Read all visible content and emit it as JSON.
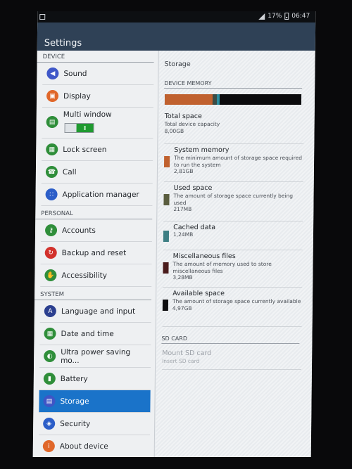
{
  "status": {
    "battery": "17%",
    "time": "06:47"
  },
  "header": {
    "title": "Settings"
  },
  "sidebar": {
    "sections": [
      {
        "header": "DEVICE",
        "items": [
          {
            "label": "Sound",
            "icon": "speaker-icon",
            "color": "#3f57c8"
          },
          {
            "label": "Display",
            "icon": "display-icon",
            "color": "#e0672a"
          },
          {
            "label": "Multi window",
            "icon": "multi-window-icon",
            "color": "#2f8e3a",
            "toggle": true
          },
          {
            "label": "Lock screen",
            "icon": "lock-screen-icon",
            "color": "#2f8e3a"
          },
          {
            "label": "Call",
            "icon": "phone-icon",
            "color": "#2f8e3a"
          },
          {
            "label": "Application manager",
            "icon": "apps-icon",
            "color": "#2c5ec8"
          }
        ]
      },
      {
        "header": "PERSONAL",
        "items": [
          {
            "label": "Accounts",
            "icon": "key-icon",
            "color": "#2f8e3a"
          },
          {
            "label": "Backup and reset",
            "icon": "backup-icon",
            "color": "#d2312c"
          },
          {
            "label": "Accessibility",
            "icon": "hand-icon",
            "color": "#2f8e3a"
          }
        ]
      },
      {
        "header": "SYSTEM",
        "items": [
          {
            "label": "Language and input",
            "icon": "language-icon",
            "color": "#2b3f8f"
          },
          {
            "label": "Date and time",
            "icon": "calendar-icon",
            "color": "#2f8e3a"
          },
          {
            "label": "Ultra power saving mo...",
            "icon": "power-saving-icon",
            "color": "#2f8e3a"
          },
          {
            "label": "Battery",
            "icon": "battery-icon",
            "color": "#2f8e3a"
          },
          {
            "label": "Storage",
            "icon": "storage-icon",
            "color": "#3e55c6",
            "selected": true
          },
          {
            "label": "Security",
            "icon": "security-icon",
            "color": "#2c5ec8"
          },
          {
            "label": "About device",
            "icon": "info-icon",
            "color": "#e0672a"
          }
        ]
      }
    ]
  },
  "main": {
    "title": "Storage",
    "device_memory_header": "DEVICE MEMORY",
    "storage_bar": [
      {
        "fraction": 0.35,
        "color": "#c0612f"
      },
      {
        "fraction": 0.03,
        "color": "#3b4c46"
      },
      {
        "fraction": 0.02,
        "color": "#2b8ea0"
      },
      {
        "fraction": 0.6,
        "color": "#0c0c0e"
      }
    ],
    "items": [
      {
        "title": "Total space",
        "desc": "Total device capacity",
        "value": "8,00GB",
        "swatch": null
      },
      {
        "title": "System memory",
        "desc": "The minimum amount of storage space required to run the system",
        "value": "2,81GB",
        "swatch": "#c0612f"
      },
      {
        "title": "Used space",
        "desc": "The amount of storage space currently being used",
        "value": "217MB",
        "swatch": "#5a5d3f"
      },
      {
        "title": "Cached data",
        "desc": "",
        "value": "1,24MB",
        "swatch": "#3e7f84"
      },
      {
        "title": "Miscellaneous files",
        "desc": "The amount of memory used to store miscellaneous files",
        "value": "3,28MB",
        "swatch": "#4a1c1c"
      },
      {
        "title": "Available space",
        "desc": "The amount of storage space currently available",
        "value": "4,97GB",
        "swatch": "#0e0e10"
      }
    ],
    "sd_card_header": "SD CARD",
    "sd": {
      "title": "Mount SD card",
      "desc": "Insert SD card"
    }
  }
}
